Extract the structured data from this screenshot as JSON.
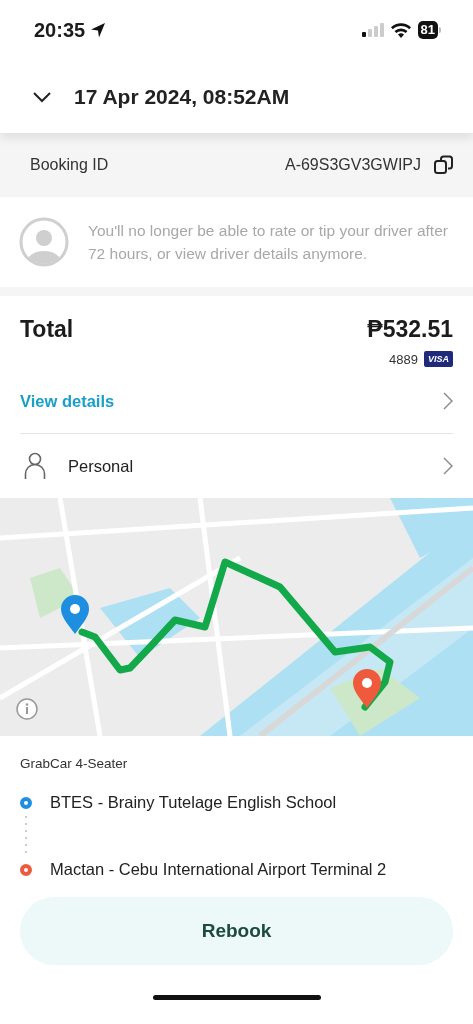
{
  "status_bar": {
    "time": "20:35",
    "battery": "81"
  },
  "header": {
    "title": "17 Apr 2024, 08:52AM"
  },
  "booking": {
    "label": "Booking ID",
    "value": "A-69S3GV3GWIPJ"
  },
  "driver_notice": "You'll no longer be able to rate or tip your driver after 72 hours, or view driver details anymore.",
  "fare": {
    "label": "Total",
    "amount": "₱532.51",
    "card_last_digits": "4889",
    "card_brand": "VISA"
  },
  "links": [
    {
      "kind": "details",
      "label": "View details"
    },
    {
      "kind": "profile",
      "label": "Personal"
    }
  ],
  "trip": {
    "vehicle": "GrabCar 4-Seater",
    "stops": [
      {
        "name": "BTES - Brainy Tutelage English School",
        "color": "#1e8fe0"
      },
      {
        "name": "Mactan - Cebu International Airport Terminal 2",
        "color": "#ef5a3c"
      }
    ]
  },
  "action": {
    "label": "Rebook"
  }
}
